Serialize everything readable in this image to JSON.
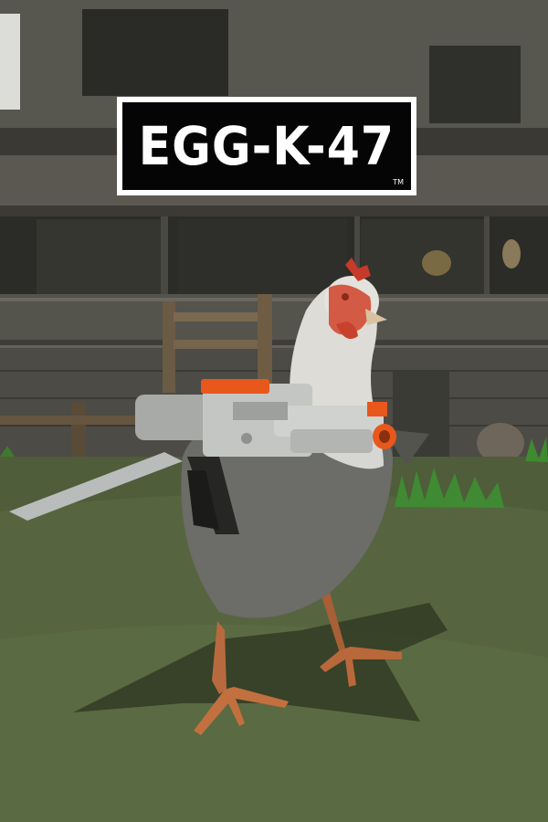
{
  "game": {
    "logo_text": "EGG-K-47",
    "trademark": "TM"
  },
  "colors": {
    "logo_background": "#050505",
    "logo_frame": "#ffffff",
    "gun_accent": "#e8571c",
    "grass": "#4b5a36"
  }
}
